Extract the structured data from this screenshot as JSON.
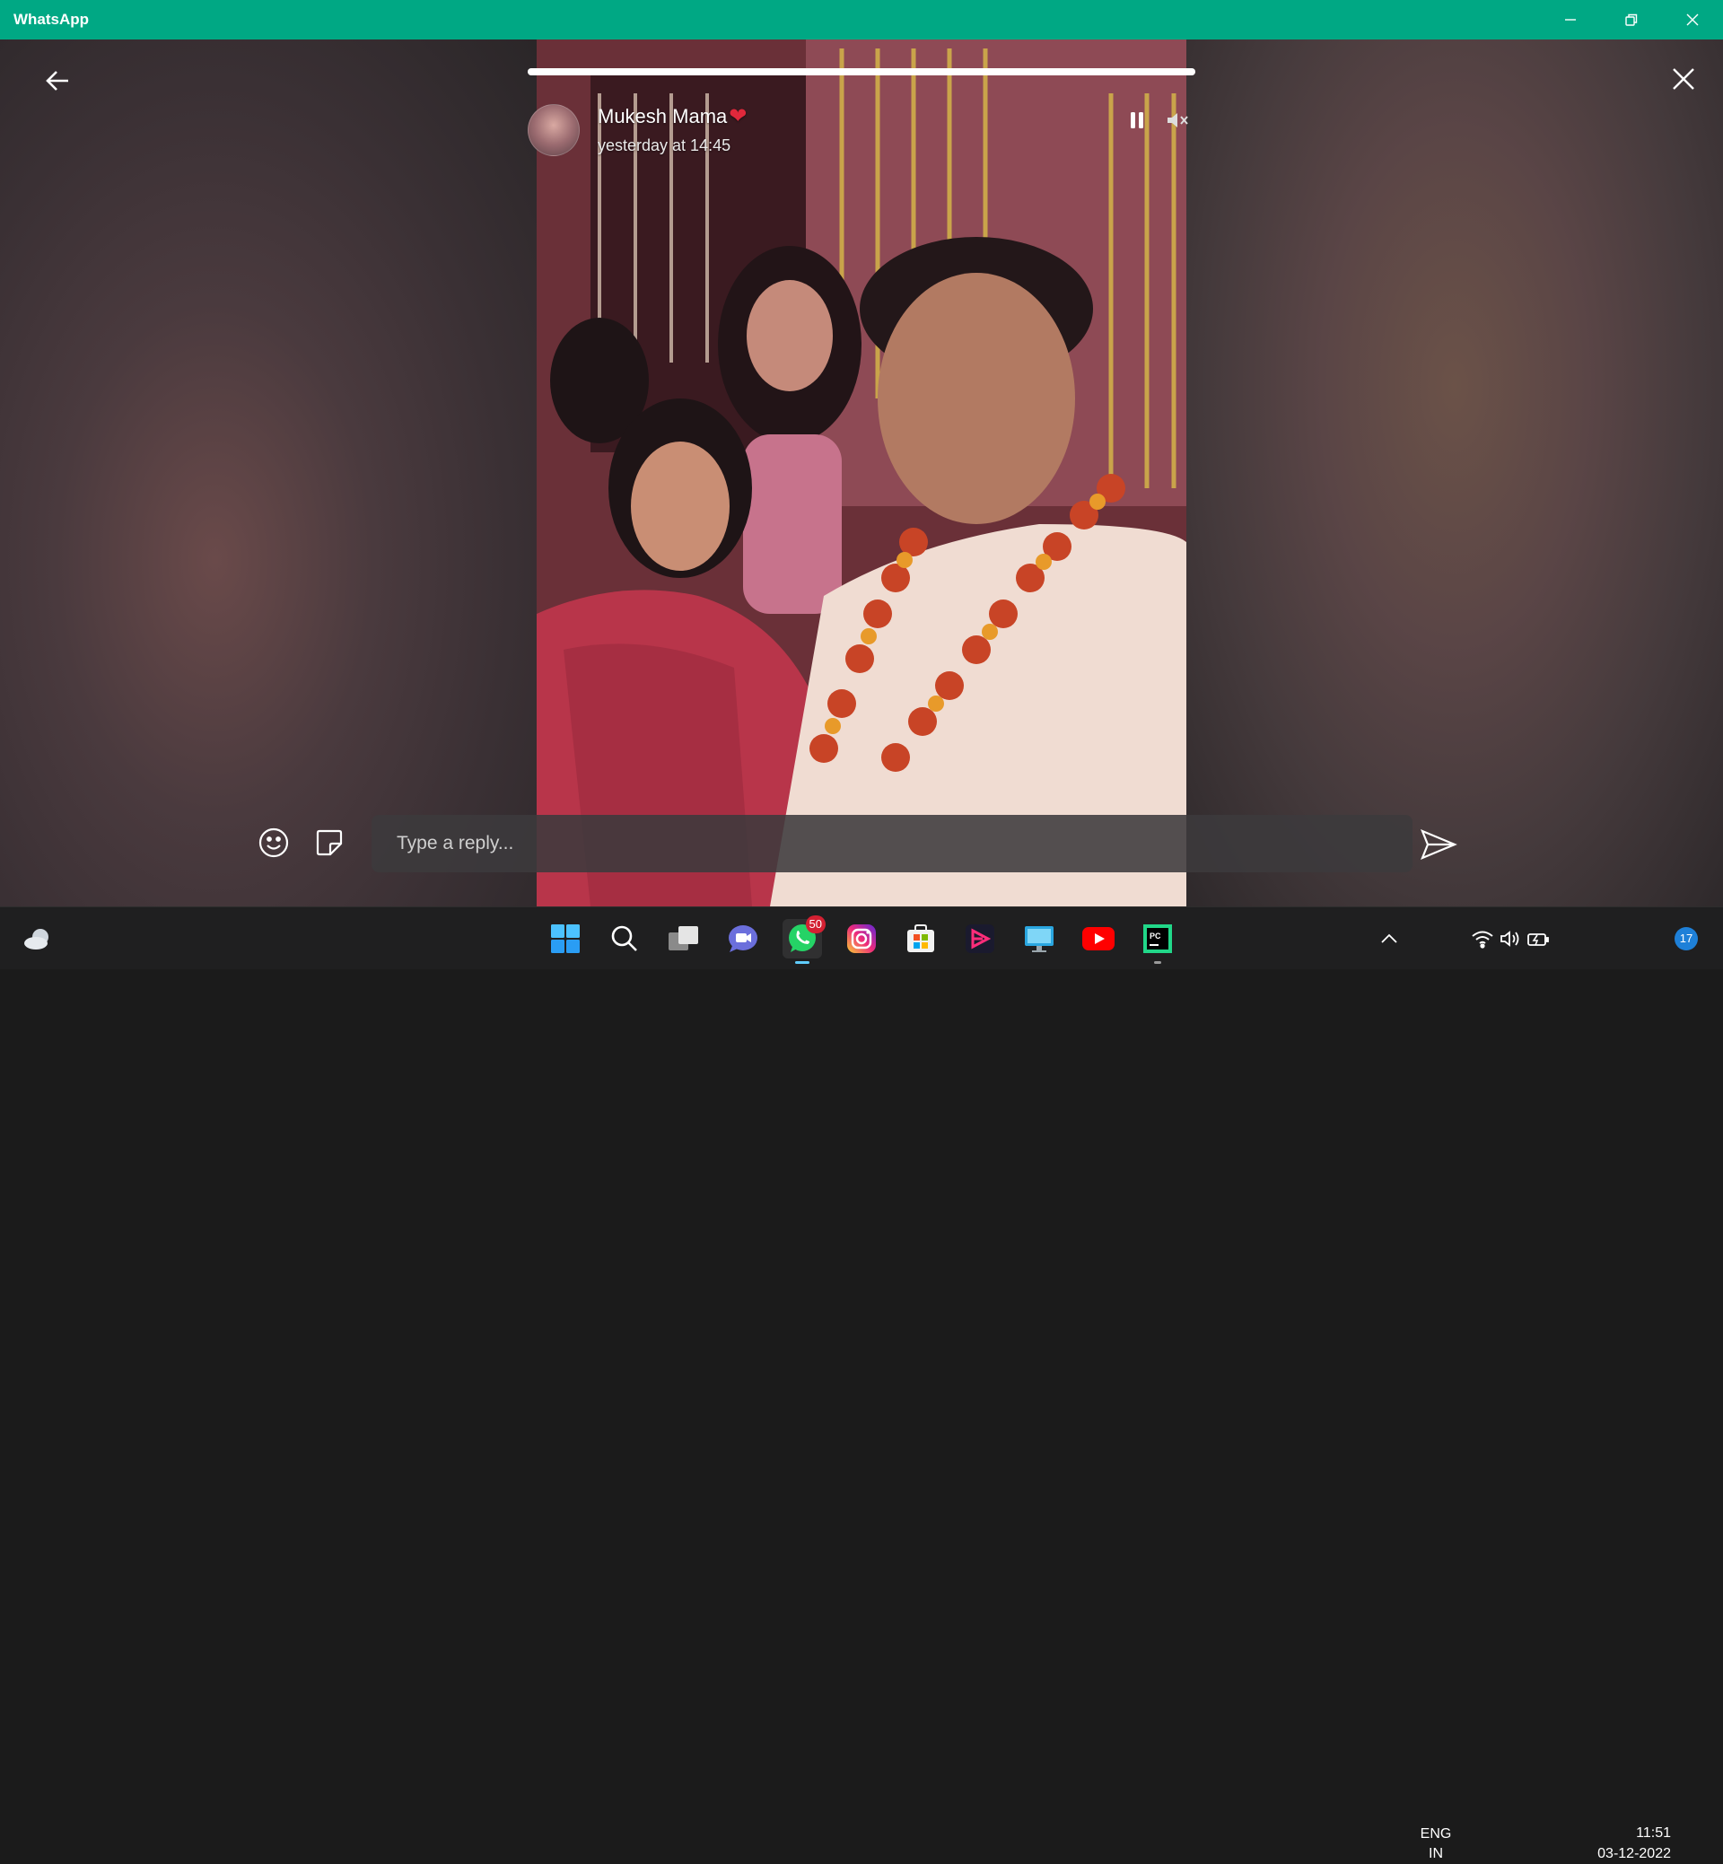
{
  "window": {
    "title": "WhatsApp"
  },
  "status": {
    "contact_name": "Mukesh Mama",
    "heart": "❤",
    "time": "yesterday at 14:45",
    "progress": 1.0,
    "playback_state": "playing",
    "muted": true
  },
  "reply": {
    "placeholder": "Type a reply..."
  },
  "taskbar": {
    "apps": [
      {
        "name": "Start",
        "icon": "windows-icon"
      },
      {
        "name": "Search",
        "icon": "search-icon"
      },
      {
        "name": "Task View",
        "icon": "task-view-icon"
      },
      {
        "name": "Teams Chat",
        "icon": "teams-chat-icon"
      },
      {
        "name": "WhatsApp",
        "icon": "whatsapp-icon",
        "badge": "50",
        "active": true
      },
      {
        "name": "Instagram",
        "icon": "instagram-icon"
      },
      {
        "name": "Microsoft Store",
        "icon": "store-icon"
      },
      {
        "name": "Video Editor",
        "icon": "video-editor-icon"
      },
      {
        "name": "Remote Desktop",
        "icon": "remote-desktop-icon"
      },
      {
        "name": "YouTube",
        "icon": "youtube-icon"
      },
      {
        "name": "PyCharm",
        "icon": "pycharm-icon"
      }
    ],
    "language_line1": "ENG",
    "language_line2": "IN",
    "time": "11:51",
    "date": "03-12-2022",
    "notification_count": "17"
  },
  "colors": {
    "titlebar": "#00a884",
    "heart": "#e0283b",
    "badge": "#d42032",
    "notification": "#1e80d8"
  }
}
